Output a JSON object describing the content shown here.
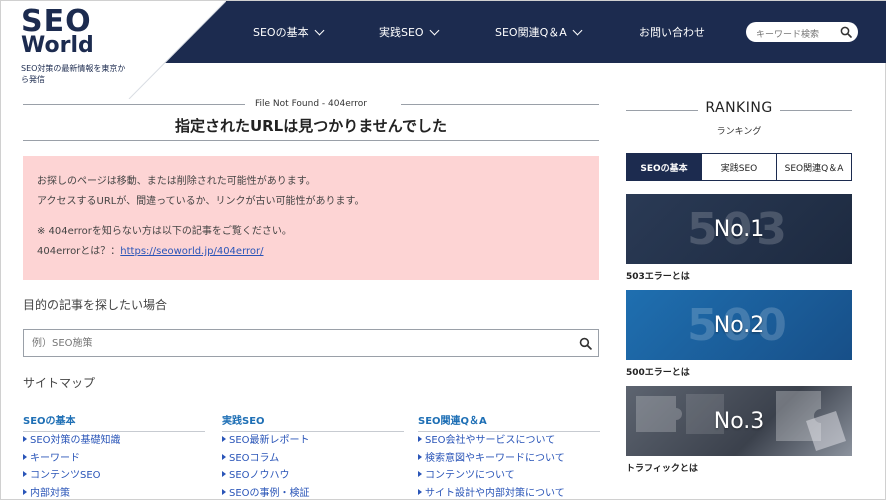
{
  "header": {
    "logo_line1": "SEO",
    "logo_line2": "World",
    "tagline": "SEO対策の最新情報を東京から発信",
    "nav": [
      {
        "label": "SEOの基本"
      },
      {
        "label": "実践SEO"
      },
      {
        "label": "SEO関連Q＆A"
      },
      {
        "label": "お問い合わせ"
      }
    ],
    "search_placeholder": "キーワード検索"
  },
  "main": {
    "error_code": "File Not Found - 404error",
    "error_title": "指定されたURLは見つかりませんでした",
    "notice": {
      "line1": "お探しのページは移動、または削除された可能性があります。",
      "line2": "アクセスするURLが、間違っているか、リンクが古い可能性があります。",
      "line3": "※ 404errorを知らない方は以下の記事をご覧ください。",
      "line4_prefix": "404errorとは？：",
      "link_text": "https://seoworld.jp/404error/"
    },
    "find_title": "目的の記事を探したい場合",
    "search_placeholder": "例）SEO施策",
    "sitemap_title": "サイトマップ",
    "columns": [
      {
        "head": "SEOの基本",
        "items": [
          "SEO対策の基礎知識",
          "キーワード",
          "コンテンツSEO",
          "内部対策"
        ]
      },
      {
        "head": "実践SEO",
        "items": [
          "SEO最新レポート",
          "SEOコラム",
          "SEOノウハウ",
          "SEOの事例・検証"
        ]
      },
      {
        "head": "SEO関連Q＆A",
        "items": [
          "SEO会社やサービスについて",
          "検索意図やキーワードについて",
          "コンテンツについて",
          "サイト設計や内部対策について"
        ]
      }
    ]
  },
  "sidebar": {
    "title": "RANKING",
    "subtitle": "ランキング",
    "tabs": [
      "SEOの基本",
      "実践SEO",
      "SEO関連Q＆A"
    ],
    "active_tab": 0,
    "cards": [
      {
        "bg_text": "503",
        "rank": "No.1",
        "caption": "503エラーとは"
      },
      {
        "bg_text": "500",
        "rank": "No.2",
        "caption": "500エラーとは"
      },
      {
        "bg_text": "",
        "rank": "No.3",
        "caption": "トラフィックとは"
      }
    ]
  },
  "colors": {
    "navy": "#1c2b4f",
    "notice_bg": "#fdd4d4",
    "link": "#2a55b8",
    "column_head": "#1e6fb5"
  }
}
